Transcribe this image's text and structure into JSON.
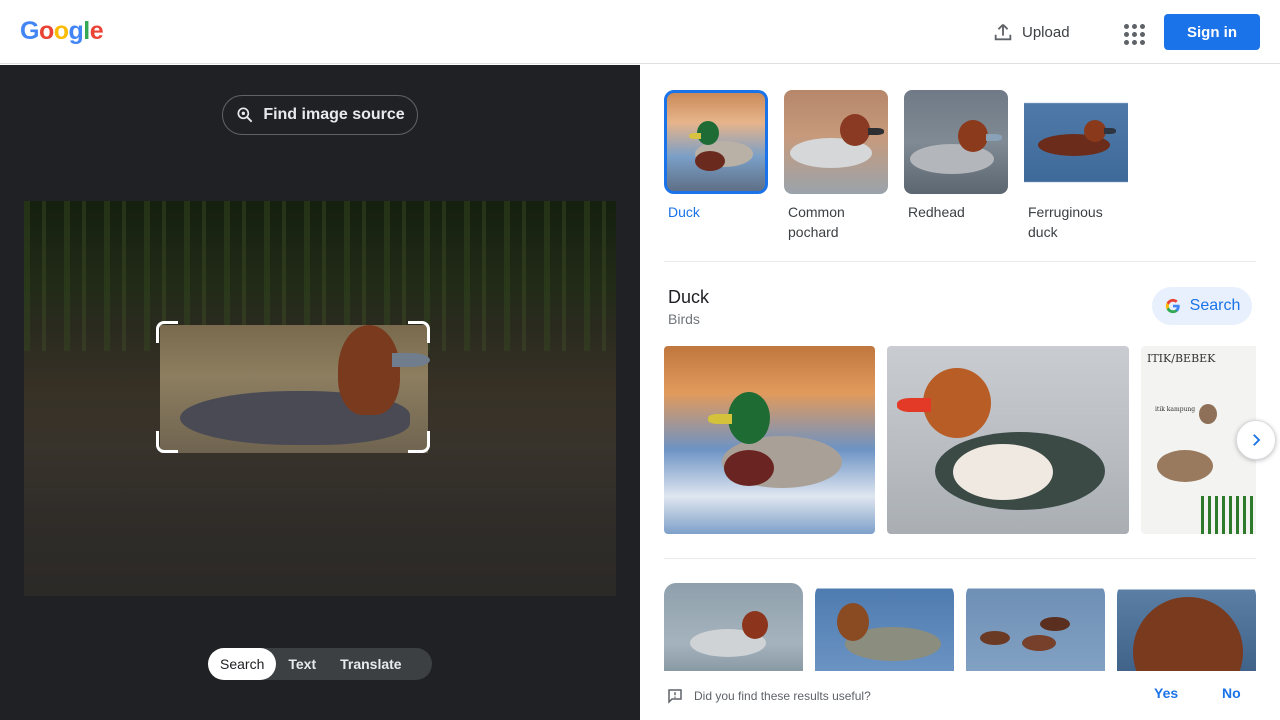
{
  "header": {
    "logo_letters": [
      {
        "char": "G",
        "color": "#4285F4"
      },
      {
        "char": "o",
        "color": "#EA4335"
      },
      {
        "char": "o",
        "color": "#FBBC05"
      },
      {
        "char": "g",
        "color": "#4285F4"
      },
      {
        "char": "l",
        "color": "#34A853"
      },
      {
        "char": "e",
        "color": "#EA4335"
      }
    ],
    "upload_label": "Upload",
    "upload_icon": "upload-icon",
    "apps_icon": "apps-grid-icon",
    "signin_label": "Sign in"
  },
  "left": {
    "find_source_label": "Find image source",
    "find_source_icon": "lens-search-icon",
    "modes": [
      {
        "label": "Search",
        "active": true
      },
      {
        "label": "Text",
        "active": false
      },
      {
        "label": "Translate",
        "active": false
      }
    ]
  },
  "right": {
    "chips": [
      {
        "label": "Duck",
        "active": true
      },
      {
        "label": "Common pochard",
        "active": false
      },
      {
        "label": "Redhead",
        "active": false
      },
      {
        "label": "Ferruginous duck",
        "active": false
      }
    ],
    "entity": {
      "title": "Duck",
      "subtitle": "Birds",
      "search_label": "Search"
    },
    "row1_overlay_text": {
      "heading": "ITIK/BEBEK",
      "caption": "itik kampung"
    },
    "feedback": {
      "question": "Did you find these results useful?",
      "yes": "Yes",
      "no": "No"
    }
  },
  "colors": {
    "accent": "#1a73e8",
    "dark_bg": "#202124",
    "chip_bg": "#e8f0fe"
  }
}
